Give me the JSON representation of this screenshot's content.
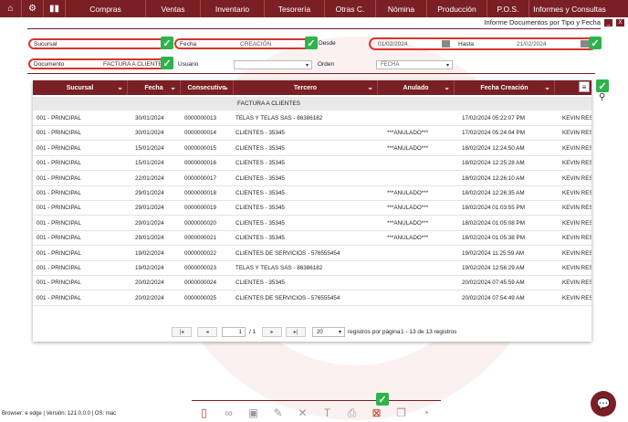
{
  "nav": {
    "items": [
      "Compras",
      "Ventas",
      "Inventario",
      "Tesorería",
      "Otras C.",
      "Nómina",
      "Producción",
      "P.O.S.",
      "Informes y Consultas"
    ]
  },
  "window": {
    "title": "Informe Documentos por Tipo y Fecha",
    "minimize": "_",
    "close": "X"
  },
  "filters": {
    "sucursal_label": "Sucursal",
    "fecha_label": "Fecha",
    "fecha_value": "CREACIÓN",
    "desde_label": "Desde",
    "desde_value": "01/02/2024",
    "hasta_label": "Hasta",
    "hasta_value": "21/02/2024",
    "documento_label": "Documento",
    "documento_value": "FACTURA A CLIENTES",
    "usuario_label": "Usuario",
    "usuario_value": "",
    "orden_label": "Orden",
    "orden_value": "FECHA"
  },
  "table": {
    "columns": [
      "Sucursal",
      "Fecha",
      "Consecutivo",
      "Tercero",
      "Anulado",
      "Fecha Creación"
    ],
    "group": "FACTURA A CLIENTES",
    "rows": [
      [
        "001 - PRINCIPAL",
        "30/01/2024",
        "0000000013",
        "TELAS Y TELAS SAS - 86386182",
        "",
        "17/02/2024 05:22:07 PM",
        "KEVIN RES"
      ],
      [
        "001 - PRINCIPAL",
        "30/01/2024",
        "0000000014",
        "CLIENTES - 35345",
        "***ANULADO***",
        "17/02/2024 05:24:04 PM",
        "KEVIN RES"
      ],
      [
        "001 - PRINCIPAL",
        "15/01/2024",
        "0000000015",
        "CLIENTES - 35345",
        "***ANULADO***",
        "18/02/2024 12:24:50 AM",
        "KEVIN RES"
      ],
      [
        "001 - PRINCIPAL",
        "15/01/2024",
        "0000000016",
        "CLIENTES - 35345",
        "",
        "18/02/2024 12:25:28 AM",
        "KEVIN RES"
      ],
      [
        "001 - PRINCIPAL",
        "22/01/2024",
        "0000000017",
        "CLIENTES - 35345",
        "",
        "18/02/2024 12:26:10 AM",
        "KEVIN RES"
      ],
      [
        "001 - PRINCIPAL",
        "29/01/2024",
        "0000000018",
        "CLIENTES - 35345",
        "***ANULADO***",
        "18/02/2024 12:26:35 AM",
        "KEVIN RES"
      ],
      [
        "001 - PRINCIPAL",
        "29/01/2024",
        "0000000019",
        "CLIENTES - 35345",
        "***ANULADO***",
        "18/02/2024 01:03:55 PM",
        "KEVIN RES"
      ],
      [
        "001 - PRINCIPAL",
        "29/01/2024",
        "0000000020",
        "CLIENTES - 35345",
        "***ANULADO***",
        "18/02/2024 01:05:08 PM",
        "KEVIN RES"
      ],
      [
        "001 - PRINCIPAL",
        "29/01/2024",
        "0000000021",
        "CLIENTES - 35345",
        "***ANULADO***",
        "18/02/2024 01:05:38 PM",
        "KEVIN RES"
      ],
      [
        "001 - PRINCIPAL",
        "19/02/2024",
        "0000000022",
        "CLIENTES DE SERVICIOS - 576555454",
        "",
        "19/02/2024 11:25:59 AM",
        "KEVIN RES"
      ],
      [
        "001 - PRINCIPAL",
        "19/02/2024",
        "0000000023",
        "TELAS Y TELAS SAS - 86386182",
        "",
        "19/02/2024 12:56:29 AM",
        "KEVIN RES"
      ],
      [
        "001 - PRINCIPAL",
        "20/02/2024",
        "0000000024",
        "CLIENTES - 35345",
        "",
        "20/02/2024 07:45:59 AM",
        "KEVIN RES"
      ],
      [
        "001 - PRINCIPAL",
        "20/02/2024",
        "0000000025",
        "CLIENTES DE SERVICIOS - 576555454",
        "",
        "20/02/2024 07:54:49 AM",
        "KEVIN RES"
      ]
    ]
  },
  "pager": {
    "page": "1",
    "of": "/ 1",
    "per_page": "20",
    "per_page_label": "registros por página",
    "summary": "1 - 13 de 13 registros"
  },
  "footer": "Browser: e edge | Versión: 121.0.0.0 | OS: mac",
  "colors": {
    "brand": "#7a1f24",
    "ok": "#2db34a",
    "highlight": "#d9342b"
  }
}
